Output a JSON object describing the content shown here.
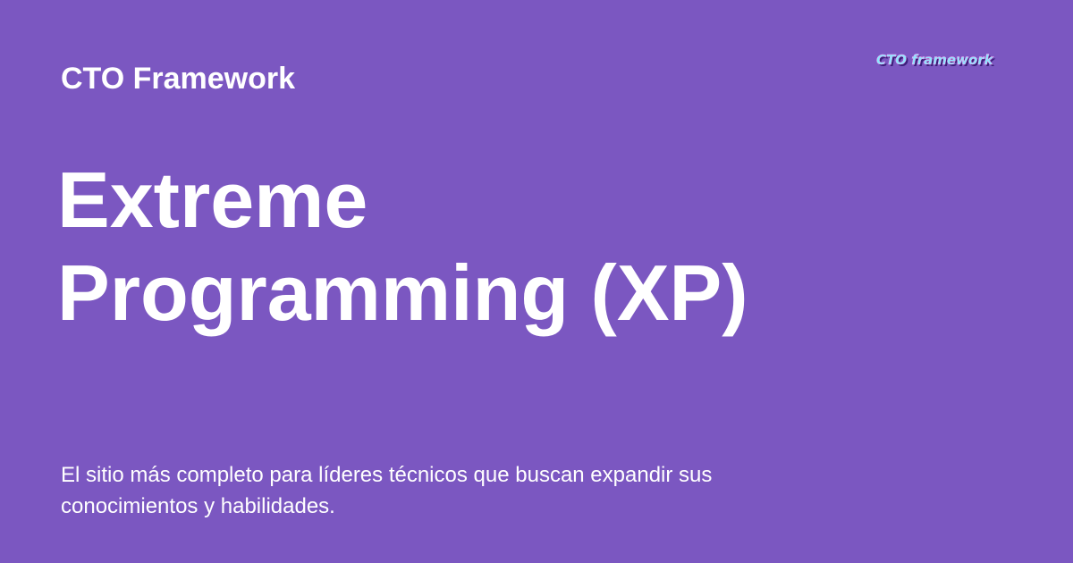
{
  "header": {
    "site_name": "CTO Framework",
    "logo_text": "CTO framework"
  },
  "main": {
    "title_line_1": "Extreme",
    "title_line_2": "Programming (XP)",
    "description": "El sitio más completo para líderes técnicos que buscan expandir sus conocimientos y habilidades."
  },
  "colors": {
    "background": "#7b57c1",
    "text": "#ffffff",
    "logo_fill": "#8de6ff",
    "logo_shadow": "#3b1f7a"
  }
}
